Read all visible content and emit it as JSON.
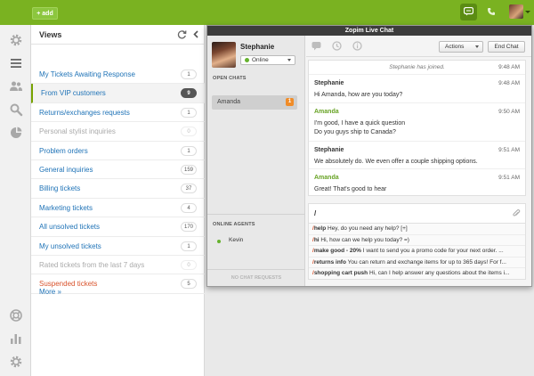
{
  "topbar": {
    "add_label": "+ add",
    "brand_color": "#7ab221"
  },
  "rail": {
    "icons": [
      "gear-icon",
      "menu-icon",
      "users-icon",
      "search-icon",
      "pie-chart-icon",
      "help-ring-icon",
      "bar-chart-icon",
      "settings-icon"
    ]
  },
  "views": {
    "title": "Views",
    "items": [
      {
        "label": "My Tickets Awaiting Response",
        "count": "1",
        "state": "normal"
      },
      {
        "label": "From VIP customers",
        "count": "9",
        "state": "active"
      },
      {
        "label": "Returns/exchanges requests",
        "count": "1",
        "state": "normal"
      },
      {
        "label": "Personal stylist inquiries",
        "count": "0",
        "state": "dim"
      },
      {
        "label": "Problem orders",
        "count": "1",
        "state": "normal"
      },
      {
        "label": "General inquiries",
        "count": "159",
        "state": "normal"
      },
      {
        "label": "Billing tickets",
        "count": "37",
        "state": "normal"
      },
      {
        "label": "Marketing tickets",
        "count": "4",
        "state": "normal"
      },
      {
        "label": "All unsolved tickets",
        "count": "170",
        "state": "normal"
      },
      {
        "label": "My unsolved tickets",
        "count": "1",
        "state": "normal"
      },
      {
        "label": "Rated tickets from the last 7 days",
        "count": "0",
        "state": "dim"
      },
      {
        "label": "Suspended tickets",
        "count": "5",
        "state": "red"
      }
    ],
    "more_label": "More »"
  },
  "zopim": {
    "title": "Zopim Live Chat",
    "agent_name": "Stephanie",
    "status": "Online",
    "open_chats_label": "OPEN CHATS",
    "open_chats": [
      {
        "name": "Amanda",
        "unread": "1"
      }
    ],
    "online_agents_label": "ONLINE AGENTS",
    "online_agents": [
      "Kevin"
    ],
    "no_requests_label": "NO CHAT REQUESTS",
    "actions_label": "Actions",
    "end_chat_label": "End Chat",
    "system_message": {
      "text": "Stephanie has joined.",
      "time": "9:48 AM"
    },
    "messages": [
      {
        "sender": "Stephanie",
        "role": "agent",
        "time": "9:48 AM",
        "lines": [
          "Hi Amanda, how are you today?"
        ]
      },
      {
        "sender": "Amanda",
        "role": "visitor",
        "time": "9:50 AM",
        "lines": [
          "I'm good, I have a quick question",
          "Do you guys ship to Canada?"
        ]
      },
      {
        "sender": "Stephanie",
        "role": "agent",
        "time": "9:51 AM",
        "lines": [
          "We absolutely do. We even offer a couple shipping options."
        ]
      },
      {
        "sender": "Amanda",
        "role": "visitor",
        "time": "9:51 AM",
        "lines": [
          "Great! That's good to hear"
        ]
      }
    ],
    "input_value": "/",
    "shortcuts": [
      {
        "cmd": "help",
        "text": "Hey, do you need any help? [+]"
      },
      {
        "cmd": "hi",
        "text": "Hi, how can we help you today? =)"
      },
      {
        "cmd": "make good - 20%",
        "text": "I want to send you a promo code for your next order. ..."
      },
      {
        "cmd": "returns info",
        "text": "You can return and exchange items for up to 365 days! For f..."
      },
      {
        "cmd": "shopping cart push",
        "text": "Hi, can I help answer any questions about the items i..."
      }
    ]
  }
}
